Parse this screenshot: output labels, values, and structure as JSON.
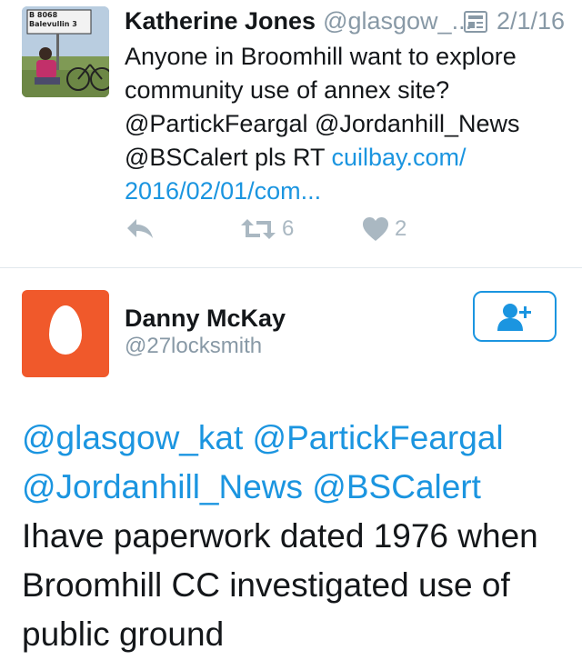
{
  "tweet": {
    "avatar": {
      "sign_line1": "B 8068",
      "sign_line2": "Balevullin 3"
    },
    "name": "Katherine Jones",
    "handle": "@glasgow_...",
    "summary_icon": "summary-card-icon",
    "date": "2/1/16",
    "text_1": "Anyone in Broomhill want to explore community use of annex site? @PartickFeargal @Jordanhill_News @BSCalert pls RT ",
    "link": "cuilbay.com/ 2016/02/01/com...",
    "actions": {
      "reply_icon": "reply-icon",
      "retweet_icon": "retweet-icon",
      "retweet_count": "6",
      "like_icon": "heart-icon",
      "like_count": "2"
    }
  },
  "reply": {
    "avatar_icon": "egg-avatar",
    "name": "Danny McKay",
    "handle": "@27locksmith",
    "follow_icon": "follow-user-icon",
    "mentions_line1": "@glasgow_kat @PartickFeargal",
    "mentions_line2": "@Jordanhill_News @BSCalert",
    "text": "Ihave paperwork dated 1976 when Broomhill CC investigated use of public ground"
  },
  "colors": {
    "link": "#1b95e0",
    "secondary": "#8899a6",
    "action_grey": "#aab8c2",
    "egg_bg": "#f0592b",
    "divider": "#e1e8ed"
  }
}
